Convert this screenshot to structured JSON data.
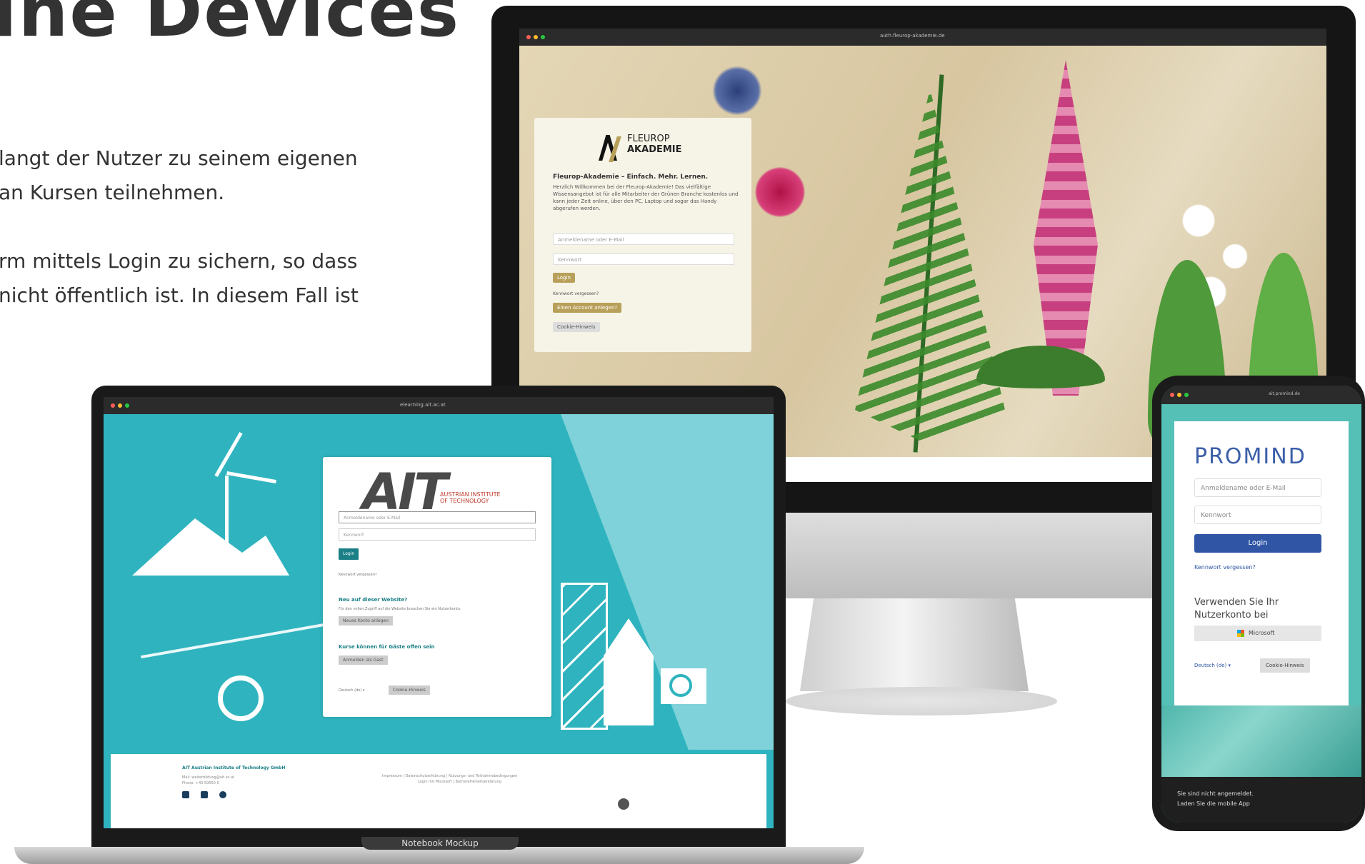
{
  "headline": "ine Devices",
  "paragraphs": {
    "p1_line1": "langt der Nutzer zu seinem eigenen",
    "p1_line2": "an Kursen teilnehmen.",
    "p2_line1": "rm mittels Login zu sichern, so dass",
    "p2_line2": "nicht öffentlich ist. In diesem Fall ist"
  },
  "imac": {
    "url": "auth.fleurop-akademie.de",
    "logo_line1": "FLEUROP",
    "logo_line2": "AKADEMIE",
    "heading": "Fleurop-Akademie – Einfach. Mehr. Lernen.",
    "intro": "Herzlich Willkommen bei der Fleurop-Akademie! Das vielfältige Wissensangebot ist für alle Mitarbeiter der Grünen Branche kostenlos und kann jeder Zeit online, über den PC, Laptop und sogar das Handy abgerufen werden.",
    "username_placeholder": "Anmeldename oder E-Mail",
    "password_placeholder": "Kennwort",
    "login_label": "Login",
    "forgot_label": "Kennwort vergessen?",
    "new_account_label": "Einen Account anlegen?",
    "cookie_label": "Cookie-Hinweis"
  },
  "macbook": {
    "url": "elearning.ait.ac.at",
    "logo": "AIT",
    "logo_sub1": "AUSTRIAN INSTITUTE",
    "logo_sub2": "OF TECHNOLOGY",
    "username_placeholder": "Anmeldename oder E-Mail",
    "password_placeholder": "Kennwort",
    "login_label": "Login",
    "forgot_label": "Kennwort vergessen?",
    "new_heading": "Neu auf dieser Website?",
    "new_text": "Für den vollen Zugriff auf die Website brauchen Sie ein Nutzerkonto.",
    "new_button": "Neues Konto anlegen",
    "guest_heading": "Kurse können für Gäste offen sein",
    "guest_button": "Anmelden als Gast",
    "language": "Deutsch (de) ▾",
    "cookie_button": "Cookie-Hinweis",
    "footer_org": "AIT Austrian Institute of Technology GmbH",
    "footer_mail": "Mail: weiterbildung@ait.ac.at",
    "footer_phone": "Phone: +43 50550-0",
    "footer_links": "Impressum | Datenschutzerklärung | Nutzungs- und Teilnahmebedingungen",
    "footer_links2": "Login mit Microsoft | Barrierefreiheitserklärung",
    "caption": "Notebook Mockup"
  },
  "phone": {
    "url": "ait.promind.de",
    "logo": "PROMIND",
    "username_placeholder": "Anmeldename oder E-Mail",
    "password_placeholder": "Kennwort",
    "login_label": "Login",
    "forgot_label": "Kennwort vergessen?",
    "sso_line1": "Verwenden Sie Ihr",
    "sso_line2": "Nutzerkonto bei",
    "microsoft_label": "Microsoft",
    "language": "Deutsch (de) ▾",
    "cookie_label": "Cookie-Hinweis",
    "not_logged_in": "Sie sind nicht angemeldet.",
    "mobile_app": "Laden Sie die mobile App"
  },
  "colors": {
    "ait_teal": "#2fb4bf",
    "ait_dark_teal": "#1a7f86",
    "promind_blue": "#2f55a4",
    "fleurop_gold": "#b8a05a"
  }
}
